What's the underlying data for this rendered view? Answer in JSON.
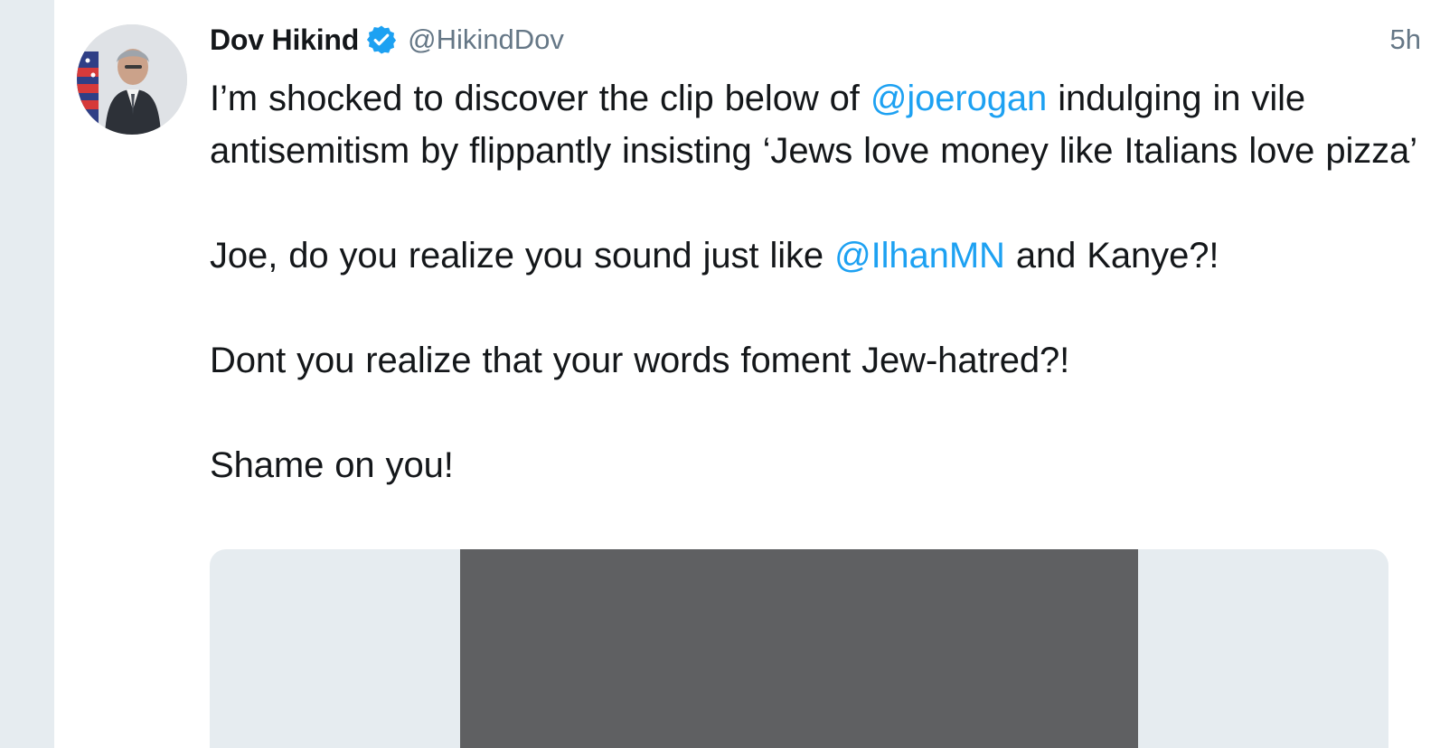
{
  "tweet": {
    "author": {
      "display_name": "Dov Hikind",
      "handle": "@HikindDov",
      "verified": true,
      "avatar_icon": "profile-photo"
    },
    "timestamp": "5h",
    "text": {
      "p1_part1": "I’m shocked to discover the clip below of ",
      "p1_mention": "@joerogan",
      "p1_part2": " indulging in vile antisemitism by flippantly insisting ‘Jews love money like Italians love pizza’",
      "p2_part1": "Joe, do you realize you sound just like ",
      "p2_mention": "@IlhanMN",
      "p2_part2": " and Kanye?!",
      "p3": "Dont you realize that your words foment Jew-hatred?!",
      "p4": "Shame on you!"
    },
    "media": {
      "type": "video"
    }
  },
  "colors": {
    "page_background": "#e6ecf0",
    "card_background": "#ffffff",
    "text_primary": "#14171a",
    "text_secondary": "#657786",
    "link": "#1da1f2",
    "media_placeholder": "#5f6062"
  }
}
